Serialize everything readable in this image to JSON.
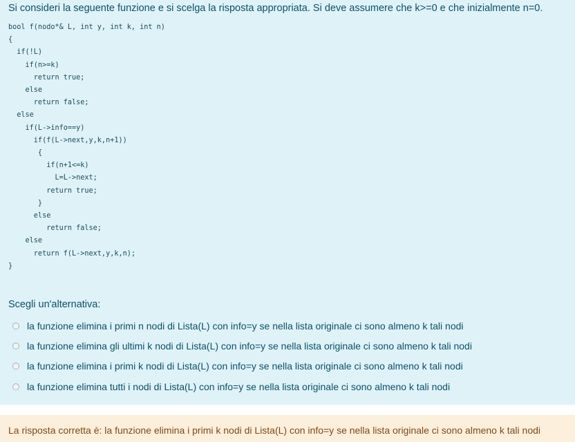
{
  "question": {
    "text": "Si consideri la seguente funzione e si scelga la risposta appropriata. Si deve assumere che k>=0 e che inizialmente n=0.",
    "code": "bool f(nodo*& L, int y, int k, int n)\n{\n  if(!L)\n    if(n>=k)\n      return true;\n    else\n      return false;\n  else\n    if(L->info==y)\n      if(f(L->next,y,k,n+1))\n       {\n         if(n+1<=k)\n           L=L->next;\n         return true;\n       }\n      else\n         return false;\n    else\n      return f(L->next,y,k,n);\n}",
    "prompt": "Scegli un'alternativa:",
    "options": [
      {
        "label": "la funzione elimina i primi n nodi di Lista(L) con info=y se nella lista originale ci sono almeno k tali nodi"
      },
      {
        "label": "la funzione elimina gli ultimi k nodi di Lista(L) con info=y se nella lista originale ci sono almeno k tali nodi"
      },
      {
        "label": "la funzione elimina  i primi k nodi di Lista(L) con info=y se nella lista originale ci sono almeno k tali nodi"
      },
      {
        "label": "la funzione elimina tutti i nodi di Lista(L) con info=y se nella lista originale ci sono almeno k tali nodi"
      }
    ]
  },
  "feedback": {
    "text": "La risposta corretta è: la funzione elimina  i primi k nodi di Lista(L) con info=y se nella lista originale ci sono almeno k tali nodi"
  }
}
